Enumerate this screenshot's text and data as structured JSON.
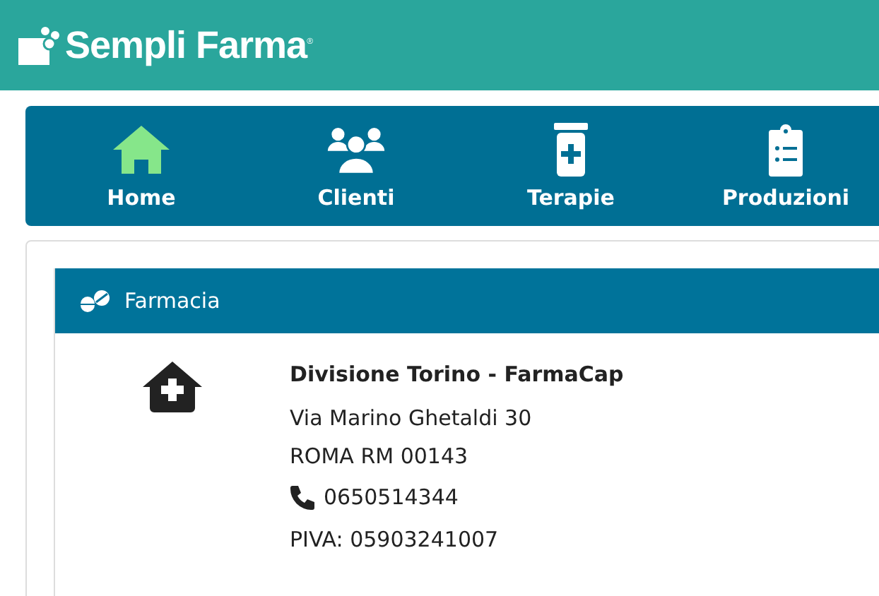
{
  "header": {
    "logo": "Sempli Farma$^{®}$"
  },
  "nav": [
    {
      "kind": "home",
      "label": "Home",
      "selected": true
    },
    {
      "kind": "clients",
      "label": "Clienti",
      "selected": false
    },
    {
      "kind": "therapies",
      "label": "Terapie",
      "selected": false
    },
    {
      "kind": "productions",
      "label": "Produzioni",
      "selected": false
    }
  ],
  "panel": {
    "title": "Farmacia",
    "name": "Divisione Torino - FarmaCap",
    "address": [
      "Via Marino Ghetaldi 30",
      "ROMA RM 00143"
    ],
    "phone": "0650514344",
    "vat": "PIVA: 05903241007"
  }
}
